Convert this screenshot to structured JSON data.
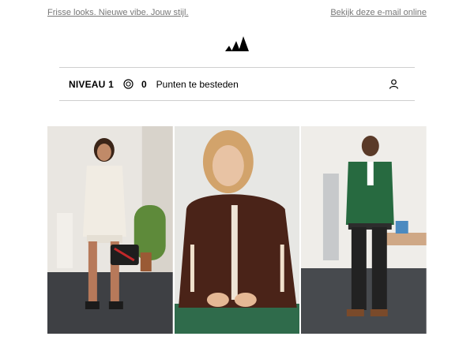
{
  "preheader": {
    "tagline": "Frisse looks. Nieuwe vibe. Jouw stijl.",
    "view_online": "Bekijk deze e-mail online"
  },
  "brand": {
    "logo_icon": "adidas-performance-logo",
    "color": "#000000"
  },
  "loyalty": {
    "level_label": "NIVEAU",
    "level_value": "1",
    "points_icon": "coin-icon",
    "points": "0",
    "points_label": "Punten te besteden",
    "account_icon": "user-icon"
  },
  "hero": {
    "panels": [
      {
        "name": "model-cream-sweater",
        "icon": "photo"
      },
      {
        "name": "model-brown-track-jacket",
        "icon": "photo"
      },
      {
        "name": "model-green-track-jacket",
        "icon": "photo"
      }
    ]
  }
}
